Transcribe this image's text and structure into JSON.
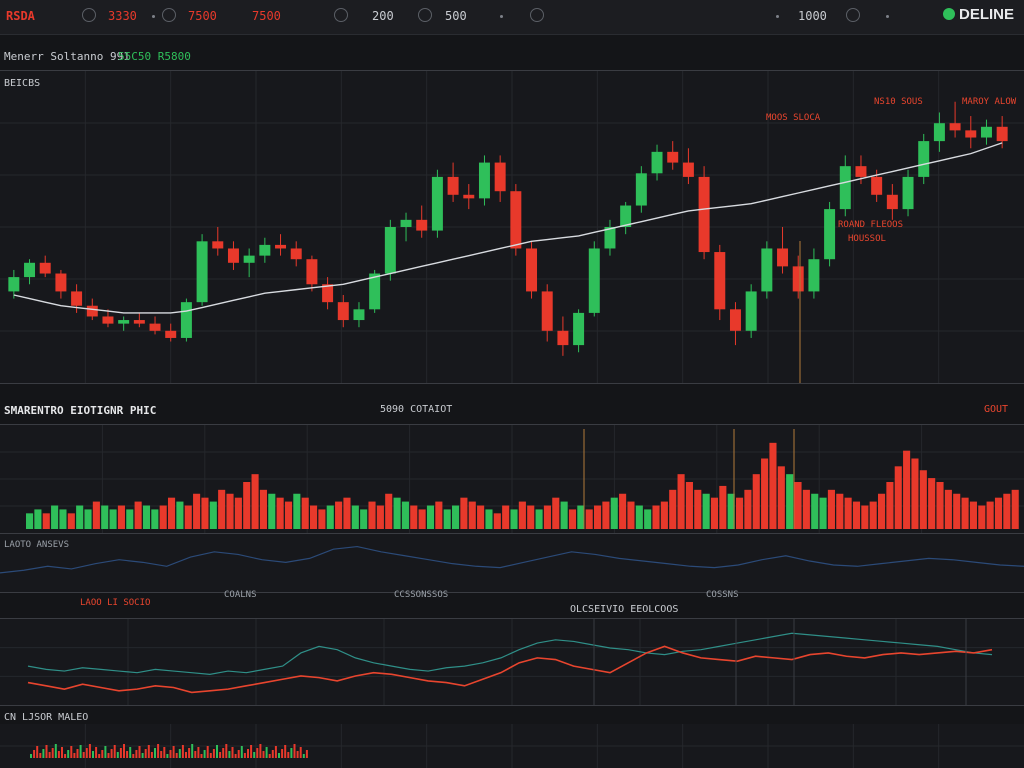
{
  "topbar": {
    "symbol": "RSDA",
    "values": [
      "3330",
      "7500",
      "7500",
      "200",
      "500",
      "1000"
    ],
    "brand": "DELINE"
  },
  "header": {
    "line1_left": "Menerr Soltanno 991",
    "line1_right": "55C50 R5800"
  },
  "price_panel": {
    "label": "BEICBS",
    "annotations": [
      "MOOS SLOCA",
      "NS10 SOUS",
      "MAROY ALOW",
      "ROAND FLEOOS",
      "HOUSSOL"
    ]
  },
  "volume_panel": {
    "title": "SMARENTRO EIOTIGNR PHIC",
    "center_label": "5090 COTAIOT",
    "right_label": "GOUT",
    "sub_label": "LAOTO ANSEVS"
  },
  "osc_panel": {
    "labels": [
      "LAOO LI SOCIO",
      "COALNS",
      "CCSSONSSOS",
      "COSSNS"
    ],
    "center_title": "OLCSEIVIO EEOLCOOS"
  },
  "bottom_panel": {
    "label": "CN LJSOR MALEO"
  },
  "colors": {
    "up": "#2fbf5a",
    "down": "#e8392b",
    "ma": "#d8dbe0",
    "osc_a": "#2f8f88",
    "osc_b": "#e8452e",
    "wave": "#2b4a78"
  },
  "chart_data": [
    {
      "type": "candlestick",
      "title": "",
      "series": [
        {
          "name": "",
          "values": [
            [
              100,
              112,
              96,
              108
            ],
            [
              108,
              118,
              104,
              116
            ],
            [
              116,
              120,
              108,
              110
            ],
            [
              110,
              112,
              96,
              100
            ],
            [
              100,
              104,
              88,
              92
            ],
            [
              92,
              96,
              84,
              86
            ],
            [
              86,
              90,
              80,
              82
            ],
            [
              82,
              86,
              78,
              84
            ],
            [
              84,
              88,
              80,
              82
            ],
            [
              82,
              86,
              76,
              78
            ],
            [
              78,
              82,
              72,
              74
            ],
            [
              74,
              96,
              72,
              94
            ],
            [
              94,
              132,
              92,
              128
            ],
            [
              128,
              136,
              120,
              124
            ],
            [
              124,
              128,
              112,
              116
            ],
            [
              116,
              124,
              108,
              120
            ],
            [
              120,
              130,
              116,
              126
            ],
            [
              126,
              132,
              120,
              124
            ],
            [
              124,
              128,
              114,
              118
            ],
            [
              118,
              120,
              100,
              104
            ],
            [
              104,
              108,
              90,
              94
            ],
            [
              94,
              98,
              80,
              84
            ],
            [
              84,
              94,
              80,
              90
            ],
            [
              90,
              112,
              88,
              110
            ],
            [
              110,
              140,
              106,
              136
            ],
            [
              136,
              144,
              128,
              140
            ],
            [
              140,
              148,
              130,
              134
            ],
            [
              134,
              168,
              130,
              164
            ],
            [
              164,
              172,
              150,
              154
            ],
            [
              154,
              160,
              146,
              152
            ],
            [
              152,
              176,
              148,
              172
            ],
            [
              172,
              176,
              150,
              156
            ],
            [
              156,
              160,
              120,
              124
            ],
            [
              124,
              128,
              96,
              100
            ],
            [
              100,
              104,
              72,
              78
            ],
            [
              78,
              86,
              64,
              70
            ],
            [
              70,
              90,
              66,
              88
            ],
            [
              88,
              128,
              86,
              124
            ],
            [
              124,
              140,
              120,
              136
            ],
            [
              136,
              150,
              132,
              148
            ],
            [
              148,
              170,
              144,
              166
            ],
            [
              166,
              182,
              162,
              178
            ],
            [
              178,
              184,
              168,
              172
            ],
            [
              172,
              180,
              160,
              164
            ],
            [
              164,
              170,
              118,
              122
            ],
            [
              122,
              126,
              84,
              90
            ],
            [
              90,
              94,
              70,
              78
            ],
            [
              78,
              104,
              74,
              100
            ],
            [
              100,
              128,
              96,
              124
            ],
            [
              124,
              136,
              110,
              114
            ],
            [
              114,
              120,
              96,
              100
            ],
            [
              100,
              124,
              96,
              118
            ],
            [
              118,
              150,
              114,
              146
            ],
            [
              146,
              176,
              142,
              170
            ],
            [
              170,
              176,
              160,
              164
            ],
            [
              164,
              168,
              150,
              154
            ],
            [
              154,
              160,
              140,
              146
            ],
            [
              146,
              168,
              142,
              164
            ],
            [
              164,
              188,
              160,
              184
            ],
            [
              184,
              200,
              178,
              194
            ],
            [
              194,
              206,
              186,
              190
            ],
            [
              190,
              198,
              180,
              186
            ],
            [
              186,
              196,
              182,
              192
            ],
            [
              192,
              198,
              180,
              184
            ]
          ]
        },
        {
          "name": "",
          "values": [
            98,
            96,
            94,
            92,
            91,
            90,
            89,
            88,
            88,
            88,
            88,
            89,
            91,
            93,
            95,
            97,
            99,
            100,
            101,
            102,
            103,
            104,
            106,
            108,
            110,
            112,
            114,
            116,
            118,
            120,
            122,
            124,
            126,
            128,
            129,
            130,
            131,
            133,
            135,
            137,
            139,
            141,
            143,
            145,
            146,
            147,
            148,
            149,
            151,
            153,
            155,
            157,
            159,
            161,
            163,
            165,
            167,
            169,
            171,
            173,
            175,
            177,
            180,
            183
          ]
        }
      ]
    },
    {
      "type": "bar",
      "title": "",
      "values": [
        4,
        5,
        4,
        6,
        5,
        4,
        6,
        5,
        7,
        6,
        5,
        6,
        5,
        7,
        6,
        5,
        6,
        8,
        7,
        6,
        9,
        8,
        7,
        10,
        9,
        8,
        12,
        14,
        10,
        9,
        8,
        7,
        9,
        8,
        6,
        5,
        6,
        7,
        8,
        6,
        5,
        7,
        6,
        9,
        8,
        7,
        6,
        5,
        6,
        7,
        5,
        6,
        8,
        7,
        6,
        5,
        4,
        6,
        5,
        7,
        6,
        5,
        6,
        8,
        7,
        5,
        6,
        5,
        6,
        7,
        8,
        9,
        7,
        6,
        5,
        6,
        7,
        10,
        14,
        12,
        10,
        9,
        8,
        11,
        9,
        8,
        10,
        14,
        18,
        22,
        16,
        14,
        12,
        10,
        9,
        8,
        10,
        9,
        8,
        7,
        6,
        7,
        9,
        12,
        16,
        20,
        18,
        15,
        13,
        12,
        10,
        9,
        8,
        7,
        6,
        7,
        8,
        9,
        10
      ],
      "up_flags": [
        1,
        1,
        0,
        1,
        1,
        0,
        1,
        1,
        0,
        1,
        1,
        0,
        1,
        0,
        1,
        1,
        0,
        0,
        1,
        0,
        0,
        0,
        1,
        0,
        0,
        0,
        0,
        0,
        0,
        1,
        0,
        0,
        1,
        0,
        0,
        0,
        1,
        0,
        0,
        1,
        1,
        0,
        0,
        0,
        1,
        1,
        0,
        0,
        1,
        0,
        1,
        1,
        0,
        0,
        0,
        1,
        0,
        0,
        1,
        0,
        0,
        1,
        0,
        0,
        1,
        0,
        1,
        0,
        0,
        0,
        1,
        0,
        0,
        1,
        1,
        0,
        0,
        0,
        0,
        0,
        0,
        1,
        0,
        0,
        1,
        0,
        0,
        0,
        0,
        0,
        0,
        1,
        0,
        0,
        1,
        1,
        0,
        0,
        0,
        0,
        0,
        0,
        0,
        0,
        0,
        0,
        0,
        0,
        0,
        0,
        0,
        0,
        0,
        0,
        0,
        0,
        0,
        0,
        0
      ]
    },
    {
      "type": "line",
      "title": "",
      "series": [
        {
          "name": "",
          "values": [
            50,
            48,
            47,
            49,
            48,
            47,
            46,
            48,
            47,
            46,
            45,
            47,
            46,
            48,
            50,
            58,
            62,
            60,
            55,
            52,
            50,
            48,
            47,
            49,
            50,
            52,
            55,
            60,
            64,
            66,
            65,
            63,
            61,
            60,
            58,
            57,
            59,
            60,
            62,
            64,
            66,
            68,
            70,
            69,
            68,
            67,
            66,
            65,
            64,
            63,
            62,
            60,
            58,
            57
          ]
        },
        {
          "name": "",
          "values": [
            40,
            38,
            36,
            39,
            37,
            35,
            36,
            38,
            37,
            34,
            35,
            36,
            38,
            40,
            42,
            44,
            43,
            41,
            44,
            46,
            45,
            43,
            41,
            40,
            38,
            42,
            46,
            52,
            55,
            54,
            50,
            48,
            46,
            52,
            58,
            62,
            58,
            55,
            54,
            53,
            56,
            55,
            54,
            57,
            58,
            56,
            55,
            57,
            58,
            57,
            58,
            59,
            58,
            60
          ]
        }
      ]
    },
    {
      "type": "line",
      "title": "",
      "series": [
        {
          "name": "",
          "values": [
            20,
            24,
            30,
            26,
            34,
            40,
            36,
            30,
            44,
            52,
            48,
            40,
            36,
            42,
            56,
            60,
            52,
            46,
            40,
            34,
            30,
            28,
            36,
            44,
            52,
            48,
            42,
            38,
            34,
            30,
            28,
            32,
            40,
            46,
            38,
            32,
            30,
            34,
            38,
            42,
            40,
            36,
            32,
            30
          ]
        }
      ]
    }
  ]
}
